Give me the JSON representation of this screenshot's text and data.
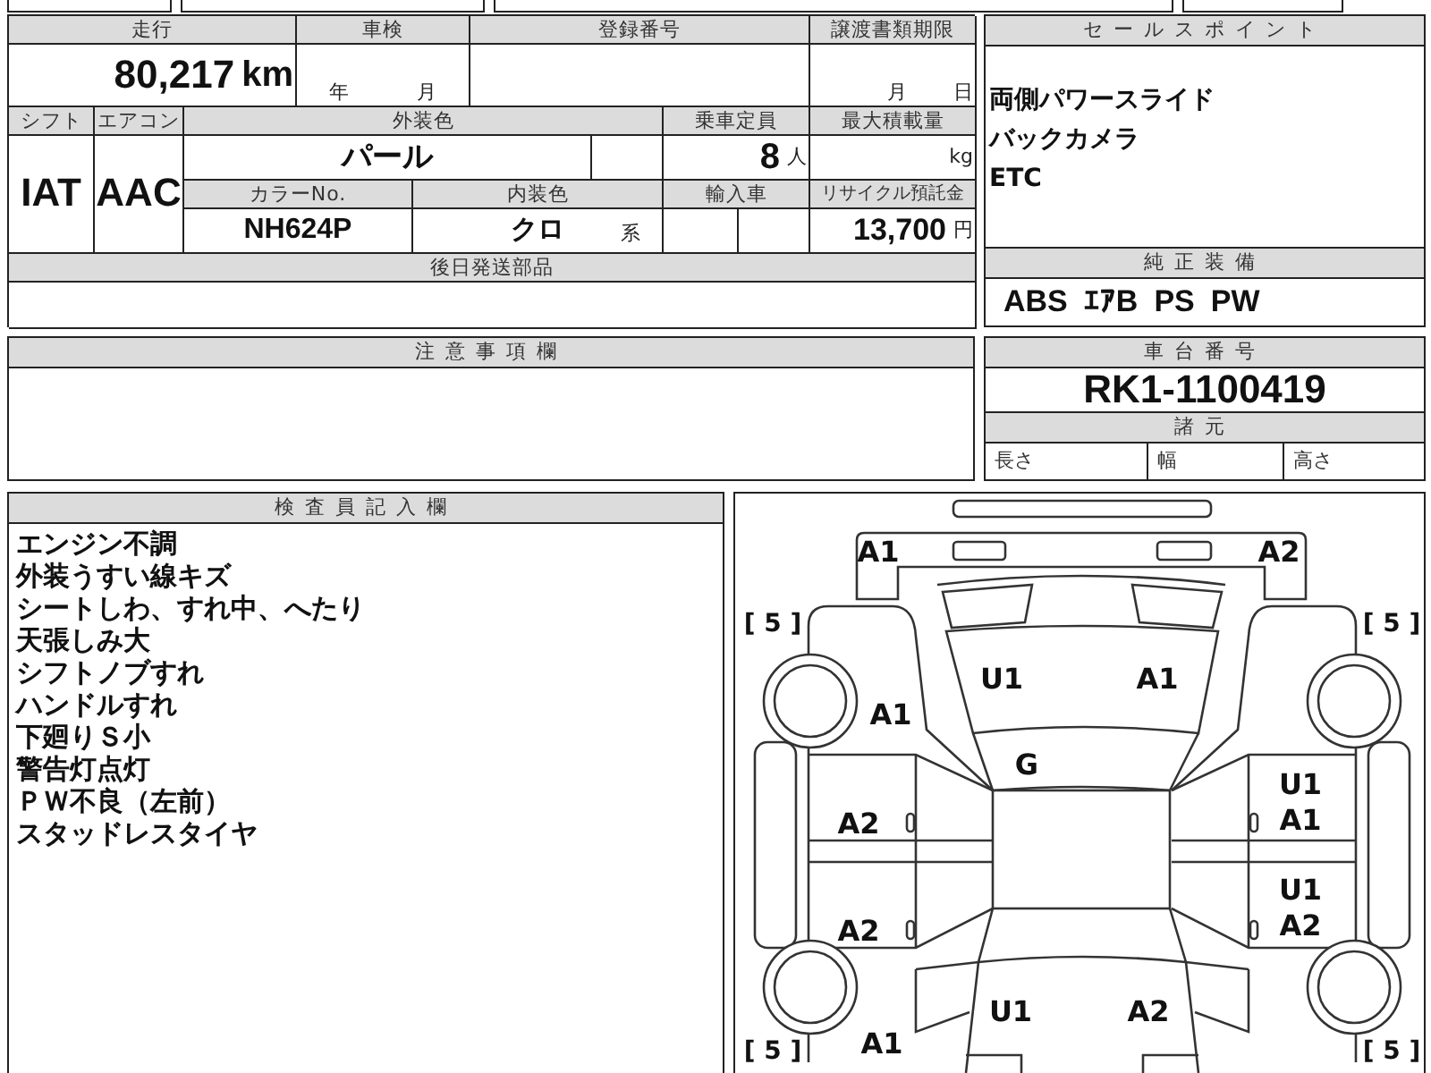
{
  "mileage": {
    "label": "走行",
    "value": "80,217",
    "unit": "km"
  },
  "inspection": {
    "label": "車検",
    "year_unit": "年",
    "month_unit": "月"
  },
  "registration": {
    "label": "登録番号"
  },
  "transfer_deadline": {
    "label": "譲渡書類期限",
    "month_unit": "月",
    "day_unit": "日"
  },
  "shift": {
    "label": "シフト",
    "value": "IAT"
  },
  "aircon": {
    "label": "エアコン",
    "value": "AAC"
  },
  "exterior_color": {
    "label": "外装色",
    "value": "パール"
  },
  "capacity": {
    "label": "乗車定員",
    "value": "8",
    "unit": "人"
  },
  "max_load": {
    "label": "最大積載量",
    "unit": "kg"
  },
  "color_no": {
    "label": "カラーNo.",
    "value": "NH624P"
  },
  "interior_color": {
    "label": "内装色",
    "value": "クロ",
    "suffix": "系"
  },
  "import": {
    "label": "輸入車"
  },
  "recycle_fee": {
    "label": "リサイクル預託金",
    "value": "13,700",
    "unit": "円"
  },
  "later_parts": {
    "label": "後日発送部品"
  },
  "sale_points": {
    "label": "セールスポイント",
    "items": [
      "両側パワースライド",
      "バックカメラ",
      "ETC"
    ]
  },
  "standard_equipment": {
    "label": "純正装備",
    "items": [
      "ABS",
      "ｴｱB",
      "PS",
      "PW"
    ]
  },
  "notes": {
    "label": "注意事項欄"
  },
  "chassis": {
    "label": "車台番号",
    "value": "RK1-1100419"
  },
  "specs": {
    "label": "諸元",
    "fields": [
      "長さ",
      "幅",
      "高さ"
    ]
  },
  "inspector": {
    "label": "検査員記入欄",
    "lines": [
      "エンジン不調",
      "外装うすい線キズ",
      "シートしわ、すれ中、へたり",
      "天張しみ大",
      "シフトノブすれ",
      "ハンドルすれ",
      "下廻りＳ小",
      "警告灯点灯",
      "ＰＷ不良（左前）",
      "スタッドレスタイヤ"
    ]
  },
  "diagram": {
    "tires": {
      "front_left": "[ 5 ]",
      "front_right": "[ 5 ]",
      "rear_left": "[ 5 ]",
      "rear_right": "[ 5 ]"
    },
    "damage": {
      "front_bumper_left": [
        "A1"
      ],
      "front_bumper_right": [
        "A2"
      ],
      "hood_left": [
        "U1"
      ],
      "hood_right": [
        "A1"
      ],
      "fender_front_left": [
        "A1"
      ],
      "windshield": [
        "G"
      ],
      "door_front_right": [
        "U1",
        "A1"
      ],
      "door_front_left": [
        "A2"
      ],
      "door_rear_right": [
        "U1",
        "A2"
      ],
      "door_rear_left": [
        "A2"
      ],
      "trunk_left": [
        "U1"
      ],
      "trunk_right": [
        "A2"
      ],
      "fender_rear_left": [
        "A1"
      ]
    }
  }
}
